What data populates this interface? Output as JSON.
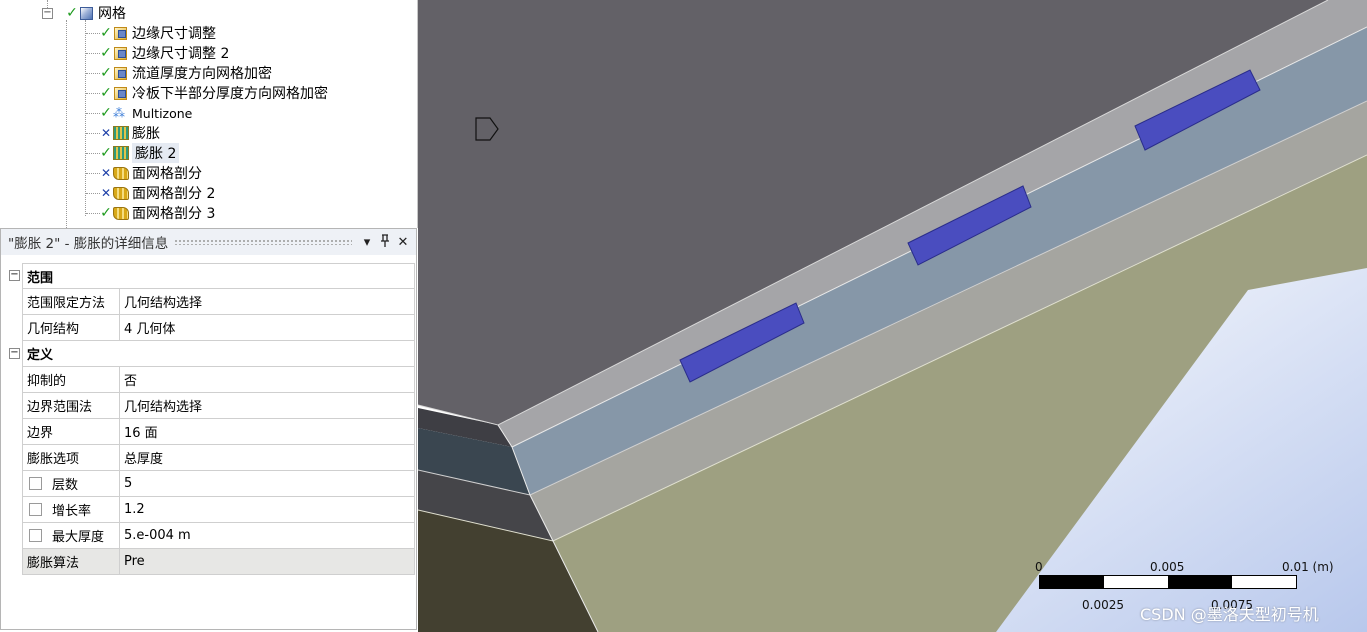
{
  "tree": {
    "mesh_label": "网格",
    "items": [
      {
        "label": "边缘尺寸调整",
        "status": "check",
        "icon": "sizing-icon"
      },
      {
        "label": "边缘尺寸调整 2",
        "status": "check",
        "icon": "sizing-icon"
      },
      {
        "label": "流道厚度方向网格加密",
        "status": "check",
        "icon": "sizing-icon"
      },
      {
        "label": "冷板下半部分厚度方向网格加密",
        "status": "check",
        "icon": "sizing-icon"
      },
      {
        "label": "Multizone",
        "status": "check",
        "icon": "multizone-icon"
      },
      {
        "label": "膨胀",
        "status": "cross",
        "icon": "inflation-icon"
      },
      {
        "label": "膨胀 2",
        "status": "check",
        "icon": "inflation-icon",
        "selected": true
      },
      {
        "label": "面网格剖分",
        "status": "cross",
        "icon": "face-meshing-icon"
      },
      {
        "label": "面网格剖分 2",
        "status": "cross",
        "icon": "face-meshing-icon"
      },
      {
        "label": "面网格剖分 3",
        "status": "check",
        "icon": "face-meshing-icon"
      }
    ]
  },
  "details": {
    "title": "\"膨胀 2\" - 膨胀的详细信息",
    "pin_glyph": "ᛒ",
    "dropdown_glyph": "▾",
    "close_glyph": "✕",
    "sections": [
      {
        "name": "范围",
        "rows": [
          {
            "key": "范围限定方法",
            "value": "几何结构选择"
          },
          {
            "key": "几何结构",
            "value": "4 几何体"
          }
        ]
      },
      {
        "name": "定义",
        "rows": [
          {
            "key": "抑制的",
            "value": "否"
          },
          {
            "key": "边界范围法",
            "value": "几何结构选择"
          },
          {
            "key": "边界",
            "value": "16 面"
          },
          {
            "key": "膨胀选项",
            "value": "总厚度"
          },
          {
            "key": "层数",
            "value": "5",
            "checkbox": true
          },
          {
            "key": "增长率",
            "value": "1.2",
            "checkbox": true
          },
          {
            "key": "最大厚度",
            "value": "5.e-004 m",
            "checkbox": true
          },
          {
            "key": "膨胀算法",
            "value": "Pre",
            "highlight": true
          }
        ]
      }
    ]
  },
  "scalebar": {
    "label_0": "0",
    "label_mid": "0.005",
    "label_end": "0.01 (m)",
    "label_q1": "0.0025",
    "label_q3": "0.0075"
  },
  "watermark": "CSDN @墨洛夫型初号机",
  "colors": {
    "top_face": "#636167",
    "side_face": "#a5a5a0",
    "blue_strip": "#8697a8",
    "olive_face": "#9ea081",
    "inlet": "#4a4dbf",
    "background_gradient_end": "#b8c8ec"
  }
}
